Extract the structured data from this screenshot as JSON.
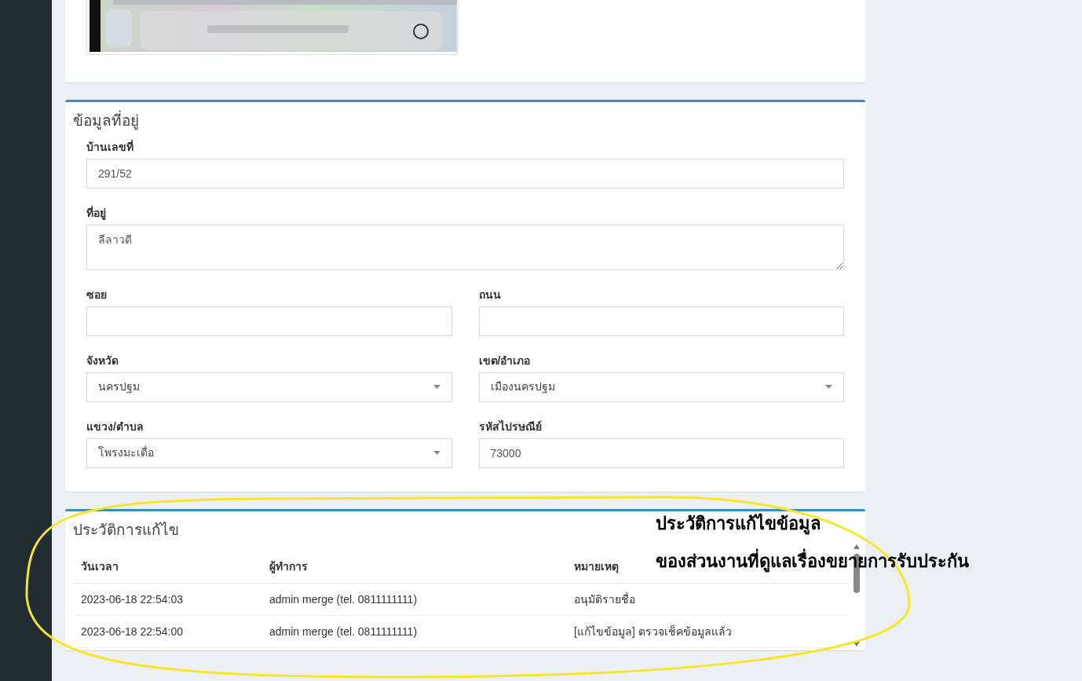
{
  "address_section": {
    "title": "ข้อมูลที่อยู่",
    "fields": [
      {
        "kind": "text",
        "label": "บ้านเลขที่",
        "value": "291/52",
        "wide": true
      },
      {
        "kind": "textarea",
        "label": "ที่อยู่",
        "value": "ลีลาวดี",
        "wide": true
      },
      {
        "kind": "text",
        "label": "ซอย",
        "wide": false
      },
      {
        "kind": "text",
        "label": "ถนน",
        "wide": false
      },
      {
        "kind": "select",
        "label": "จังหวัด",
        "value": "นครปฐม",
        "wide": false
      },
      {
        "kind": "select",
        "label": "เขต/อำเภอ",
        "value": "เมืองนครปฐม",
        "wide": false
      },
      {
        "kind": "select",
        "label": "แขวง/ตำบล",
        "value": "โพรงมะเดื่อ",
        "wide": false
      },
      {
        "kind": "text",
        "label": "รหัสไปรษณีย์",
        "value": "73000",
        "wide": false
      }
    ]
  },
  "history_section": {
    "title": "ประวัติการแก้ไข",
    "columns": [
      "วันเวลา",
      "ผู้ทำการ",
      "หมายเหตุ"
    ],
    "rows": [
      [
        "2023-06-18 22:54:03",
        "admin merge (tel. 0811111111)",
        "อนุมัติรายชื่อ"
      ],
      [
        "2023-06-18 22:54:00",
        "admin merge (tel. 0811111111)",
        "[แก้ไขข้อมูล] ตรวจเช็คข้อมูลแล้ว"
      ]
    ]
  },
  "annotation": {
    "lines": [
      "ประวัติการแก้ไขข้อมูล",
      "ของส่วนงานที่ดูแลเรื่องขยายการรับประกัน"
    ]
  }
}
